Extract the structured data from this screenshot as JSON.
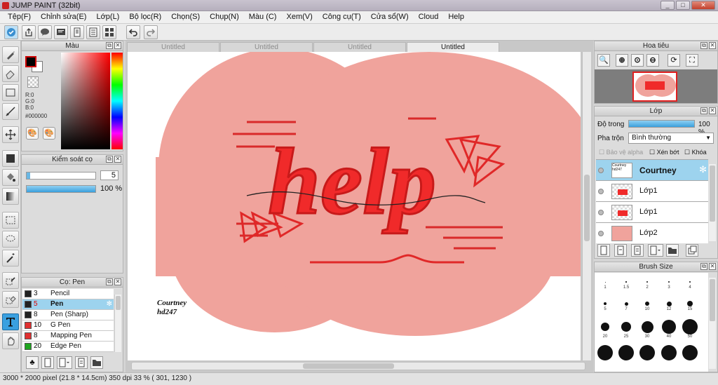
{
  "window": {
    "title": "JUMP PAINT (32bit)"
  },
  "menu": [
    "Tệp(F)",
    "Chỉnh sửa(E)",
    "Lớp(L)",
    "Bộ lọc(R)",
    "Chọn(S)",
    "Chụp(N)",
    "Màu (C)",
    "Xem(V)",
    "Công cụ(T)",
    "Cửa sổ(W)",
    "Cloud",
    "Help"
  ],
  "doc_tabs": [
    "Untitled",
    "Untitled",
    "Untitled",
    "Untitled"
  ],
  "color_panel": {
    "title": "Màu",
    "r": "R:0",
    "g": "G:0",
    "b": "B:0",
    "hex": "#000000",
    "fg": "#000000",
    "bg": "#ffffff"
  },
  "brush_control": {
    "title": "Kiểm soát cọ",
    "size": "5",
    "opacity": "100 %",
    "opacity_fraction": 1.0,
    "size_fraction": 0.05
  },
  "pen_panel": {
    "title": "Cọ: Pen",
    "items": [
      {
        "size": "3",
        "name": "Pencil",
        "color": "#222222"
      },
      {
        "size": "5",
        "name": "Pen",
        "color": "#222222",
        "selected": true
      },
      {
        "size": "8",
        "name": "Pen (Sharp)",
        "color": "#222222"
      },
      {
        "size": "10",
        "name": "G Pen",
        "color": "#e03030"
      },
      {
        "size": "8",
        "name": "Mapping Pen",
        "color": "#e03030"
      },
      {
        "size": "20",
        "name": "Edge Pen",
        "color": "#1fa51f"
      }
    ]
  },
  "navigator": {
    "title": "Hoa tiêu"
  },
  "layers": {
    "title": "Lớp",
    "opacity_label": "Độ trong",
    "opacity": "100 %",
    "opacity_fraction": 1.0,
    "blend_label": "Pha trộn",
    "blend": "Bình thường",
    "protect_alpha": "Bảo vệ alpha",
    "clipping": "Xén bớt",
    "lock": "Khóa",
    "items": [
      {
        "name": "Courtney",
        "thumb": "Courtney hd247",
        "selected": true
      },
      {
        "name": "Lớp1"
      },
      {
        "name": "Lớp1"
      },
      {
        "name": "Lớp2"
      }
    ]
  },
  "brush_size": {
    "title": "Brush Size",
    "labels": [
      "1",
      "1.5",
      "2",
      "3",
      "4",
      "5",
      "7",
      "10",
      "12",
      "15",
      "20",
      "25",
      "30",
      "40",
      "50"
    ]
  },
  "canvas": {
    "title_word": "help",
    "signature_top": "Courtney",
    "signature_bottom": "hd247",
    "colors": {
      "blob": "#f0a39c",
      "red": "#f02a2a",
      "dark": "#c81a1a"
    }
  },
  "status": "3000 * 2000 pixel   (21.8 * 14.5cm)   350 dpi   33 %   ( 301, 1230 )"
}
